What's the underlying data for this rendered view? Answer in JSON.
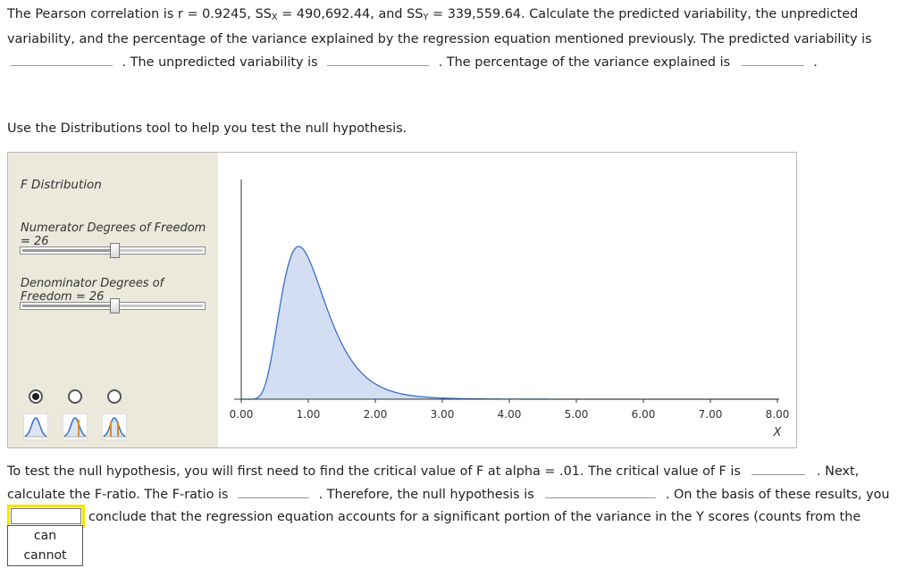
{
  "question": {
    "line1": "The Pearson correlation is r = 0.9245, SS",
    "line1_sub_x": "X",
    "line1_mid": " = 490,692.44, and SS",
    "line1_sub_y": "Y",
    "line1_end": " = 339,559.64. Calculate the predicted variability, the unpredicted",
    "line2": "variability, and the percentage of the variance explained by the regression equation mentioned previously. The predicted variability is",
    "line3_a": ". The unpredicted variability is",
    "line3_b": ". The percentage of the variance explained is",
    "line3_end": "."
  },
  "instruction": "Use the Distributions tool to help you test the null hypothesis.",
  "tool": {
    "title": "F Distribution",
    "numerator_label": "Numerator Degrees of Freedom = 26",
    "numerator_value": 26,
    "denominator_label": "Denominator Degrees of Freedom = 26",
    "denominator_value": 26,
    "slider_position_fraction": 0.5,
    "radio_selected_index": 0,
    "curve_color": "#3a6fc8",
    "fill_color": "#d3def2",
    "icons": [
      "distribution-curve-icon",
      "one-tail-cutoff-icon",
      "two-tail-cutoff-icon"
    ]
  },
  "chart_data": {
    "type": "area",
    "title": "",
    "xlabel": "X",
    "ylabel": "",
    "xlim": [
      0,
      8
    ],
    "x_ticks": [
      "0.00",
      "1.00",
      "2.00",
      "3.00",
      "4.00",
      "5.00",
      "6.00",
      "7.00",
      "8.00"
    ],
    "series": [
      {
        "distribution": "F",
        "df1": 26,
        "df2": 26
      }
    ],
    "grid": false
  },
  "bottom": {
    "line1": "To test the null hypothesis, you will first need to find the critical value of F at alpha = .01. The critical value of F is",
    "line1_end": ". Next,",
    "line2_a": "calculate the F-ratio. The F-ratio is",
    "line2_b": ". Therefore, the null hypothesis is",
    "line2_c": ". On the basis of these results, you",
    "line3": "conclude that the regression equation accounts for a significant portion of the variance in the Y scores (counts from the"
  },
  "dropdown": {
    "selected": "",
    "options": [
      "can",
      "cannot"
    ]
  }
}
